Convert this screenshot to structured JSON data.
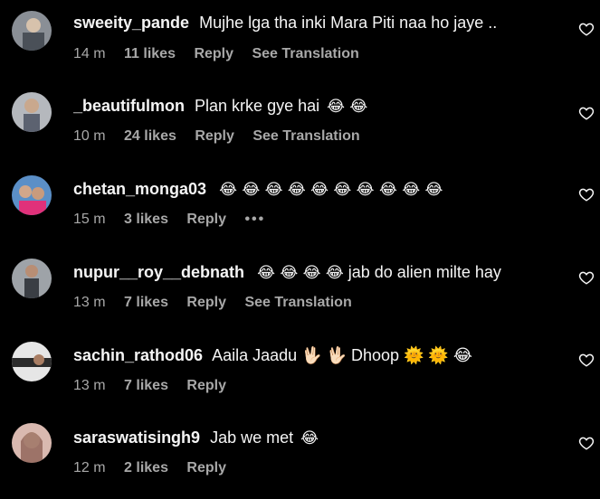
{
  "comments": [
    {
      "user": "sweeity_pande",
      "text": "Mujhe lga tha inki Mara Piti naa ho jaye ..",
      "emoji": "",
      "time": "14 m",
      "likes": "11 likes",
      "reply": "Reply",
      "translate": "See Translation"
    },
    {
      "user": "_beautifulmon",
      "text": "Plan krke gye hai",
      "emoji": "😂 😂",
      "time": "10 m",
      "likes": "24 likes",
      "reply": "Reply",
      "translate": "See Translation"
    },
    {
      "user": "chetan_monga03",
      "text": "",
      "emoji": "😂 😂 😂 😂 😂 😂 😂 😂 😂 😂",
      "time": "15 m",
      "likes": "3 likes",
      "reply": "Reply",
      "more": "•••"
    },
    {
      "user": "nupur__roy__debnath",
      "text": "jab do alien milte hay",
      "emoji": "😂 😂 😂 😂",
      "time": "13 m",
      "likes": "7 likes",
      "reply": "Reply",
      "translate": "See Translation"
    },
    {
      "user": "sachin_rathod06",
      "text": "Aaila Jaadu 🖖🏻 🖖🏻 Dhoop 🌞 🌞 😂",
      "emoji": "",
      "time": "13 m",
      "likes": "7 likes",
      "reply": "Reply"
    },
    {
      "user": "saraswatisingh9",
      "text": "Jab we met",
      "emoji": "😂",
      "time": "12 m",
      "likes": "2 likes",
      "reply": "Reply"
    }
  ],
  "icons": {
    "like": "heart-outline-icon"
  },
  "colors": {
    "background": "#000000",
    "text": "#f5f5f5",
    "meta": "#a8a8a8"
  }
}
